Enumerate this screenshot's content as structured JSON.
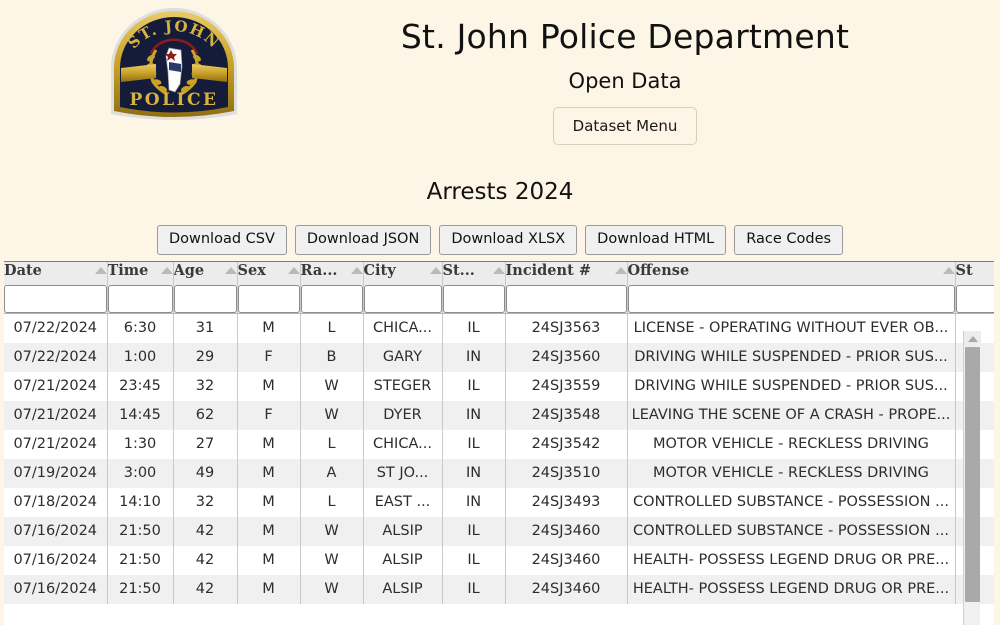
{
  "header": {
    "badge": {
      "icon": "police-badge-icon",
      "top_text": "ST. JOHN",
      "bottom_text": "POLICE",
      "navy": "#141c3a",
      "gold": "#c9a227"
    },
    "title": "St. John Police Department",
    "subtitle": "Open Data",
    "dataset_menu_label": "Dataset Menu"
  },
  "dataset": {
    "heading": "Arrests 2024",
    "actions": [
      {
        "label": "Download CSV"
      },
      {
        "label": "Download JSON"
      },
      {
        "label": "Download XLSX"
      },
      {
        "label": "Download HTML"
      },
      {
        "label": "Race Codes"
      }
    ]
  },
  "table": {
    "filter_placeholder": "",
    "columns": [
      {
        "key": "date",
        "label": "Date",
        "filter_value": "",
        "sort_icon": "sort-ascending-icon"
      },
      {
        "key": "time",
        "label": "Time",
        "filter_value": "",
        "sort_icon": "sort-ascending-icon"
      },
      {
        "key": "age",
        "label": "Age",
        "filter_value": "",
        "sort_icon": "sort-ascending-icon"
      },
      {
        "key": "sex",
        "label": "Sex",
        "filter_value": "",
        "sort_icon": "sort-ascending-icon"
      },
      {
        "key": "race",
        "label": "Ra...",
        "filter_value": "",
        "sort_icon": "sort-ascending-icon"
      },
      {
        "key": "city",
        "label": "City",
        "filter_value": "",
        "sort_icon": "sort-ascending-icon"
      },
      {
        "key": "state",
        "label": "St...",
        "filter_value": "",
        "sort_icon": "sort-ascending-icon"
      },
      {
        "key": "incident",
        "label": "Incident #",
        "filter_value": "",
        "sort_icon": "sort-ascending-icon"
      },
      {
        "key": "offense",
        "label": "Offense",
        "filter_value": "",
        "sort_icon": "sort-ascending-icon"
      },
      {
        "key": "status",
        "label": "St",
        "filter_value": "",
        "sort_icon": "sort-ascending-icon"
      }
    ],
    "rows": [
      {
        "date": "07/22/2024",
        "time": "6:30",
        "age": "31",
        "sex": "M",
        "race": "L",
        "city": "CHICA...",
        "state": "IL",
        "incident": "24SJ3563",
        "offense": "LICENSE - OPERATING WITHOUT EVER OB...",
        "status": ""
      },
      {
        "date": "07/22/2024",
        "time": "1:00",
        "age": "29",
        "sex": "F",
        "race": "B",
        "city": "GARY",
        "state": "IN",
        "incident": "24SJ3560",
        "offense": "DRIVING WHILE SUSPENDED - PRIOR SUS...",
        "status": ""
      },
      {
        "date": "07/21/2024",
        "time": "23:45",
        "age": "32",
        "sex": "M",
        "race": "W",
        "city": "STEGER",
        "state": "IL",
        "incident": "24SJ3559",
        "offense": "DRIVING WHILE SUSPENDED - PRIOR SUS...",
        "status": ""
      },
      {
        "date": "07/21/2024",
        "time": "14:45",
        "age": "62",
        "sex": "F",
        "race": "W",
        "city": "DYER",
        "state": "IN",
        "incident": "24SJ3548",
        "offense": "LEAVING THE SCENE OF A CRASH - PROPE...",
        "status": ""
      },
      {
        "date": "07/21/2024",
        "time": "1:30",
        "age": "27",
        "sex": "M",
        "race": "L",
        "city": "CHICA...",
        "state": "IL",
        "incident": "24SJ3542",
        "offense": "MOTOR VEHICLE - RECKLESS DRIVING",
        "status": ""
      },
      {
        "date": "07/19/2024",
        "time": "3:00",
        "age": "49",
        "sex": "M",
        "race": "A",
        "city": "ST JO...",
        "state": "IN",
        "incident": "24SJ3510",
        "offense": "MOTOR VEHICLE - RECKLESS DRIVING",
        "status": ""
      },
      {
        "date": "07/18/2024",
        "time": "14:10",
        "age": "32",
        "sex": "M",
        "race": "L",
        "city": "EAST ...",
        "state": "IN",
        "incident": "24SJ3493",
        "offense": "CONTROLLED SUBSTANCE - POSSESSION ...",
        "status": ""
      },
      {
        "date": "07/16/2024",
        "time": "21:50",
        "age": "42",
        "sex": "M",
        "race": "W",
        "city": "ALSIP",
        "state": "IL",
        "incident": "24SJ3460",
        "offense": "CONTROLLED SUBSTANCE - POSSESSION ...",
        "status": ""
      },
      {
        "date": "07/16/2024",
        "time": "21:50",
        "age": "42",
        "sex": "M",
        "race": "W",
        "city": "ALSIP",
        "state": "IL",
        "incident": "24SJ3460",
        "offense": "HEALTH- POSSESS LEGEND DRUG OR PRE...",
        "status": ""
      },
      {
        "date": "07/16/2024",
        "time": "21:50",
        "age": "42",
        "sex": "M",
        "race": "W",
        "city": "ALSIP",
        "state": "IL",
        "incident": "24SJ3460",
        "offense": "HEALTH- POSSESS LEGEND DRUG OR PRE...",
        "status": ""
      }
    ]
  },
  "scrollbar": {
    "up_arrow_icon": "scroll-up-arrow-icon"
  }
}
